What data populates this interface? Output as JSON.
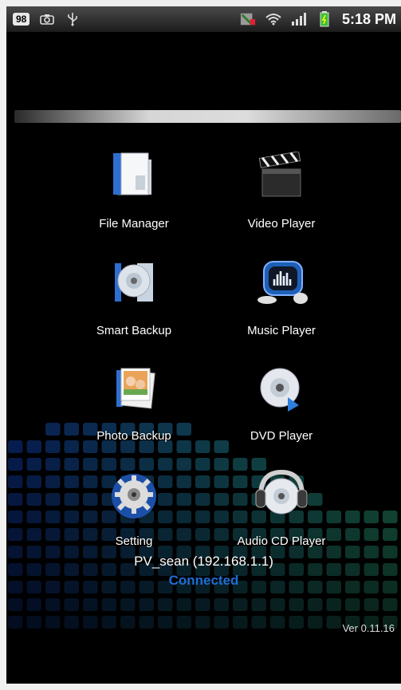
{
  "status_bar": {
    "notification_count": "98",
    "time": "5:18 PM",
    "icons": [
      "camera-icon",
      "usb-icon",
      "sim-icon",
      "wifi-icon",
      "signal-icon",
      "battery-icon"
    ]
  },
  "apps": [
    {
      "label": "File Manager",
      "icon": "file-manager-icon"
    },
    {
      "label": "Video Player",
      "icon": "video-player-icon"
    },
    {
      "label": "Smart Backup",
      "icon": "smart-backup-icon"
    },
    {
      "label": "Music Player",
      "icon": "music-player-icon"
    },
    {
      "label": "Photo Backup",
      "icon": "photo-backup-icon"
    },
    {
      "label": "DVD Player",
      "icon": "dvd-player-icon"
    },
    {
      "label": "Setting",
      "icon": "setting-icon"
    },
    {
      "label": "Audio CD Player",
      "icon": "audio-cd-player-icon"
    }
  ],
  "connection": {
    "device": "PV_sean (192.168.1.1)",
    "status": "Connected"
  },
  "version": "Ver 0.11.16",
  "colors": {
    "status_connected": "#1e6ed6",
    "eq_dark": "#0b2a55",
    "eq_teal": "#1f7a7a"
  }
}
